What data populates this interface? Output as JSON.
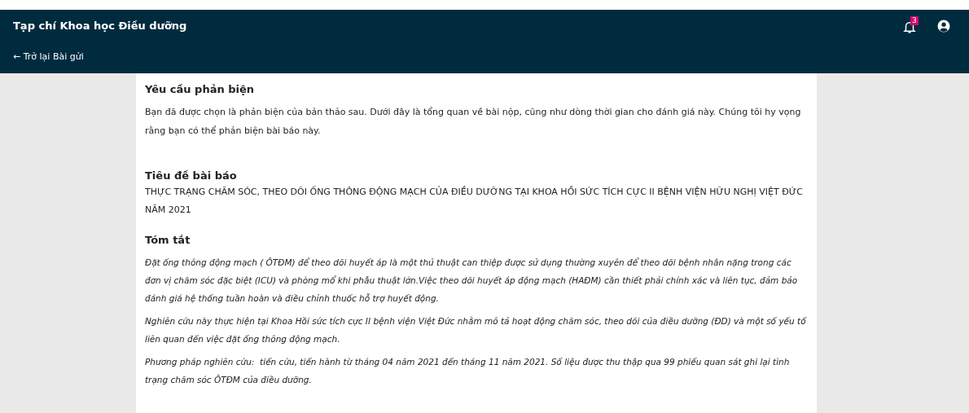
{
  "header": {
    "title": "Tạp chí Khoa học Điều dưỡng",
    "back_link": "← Trở lại Bài gửi",
    "notifications": {
      "count": "3"
    }
  },
  "content": {
    "request": {
      "heading": "Yêu cầu phản biện",
      "text": "Bạn đã được chọn là phản biện của bản thảo sau. Dưới đây là tổng quan về bài nộp, cũng như dòng thời gian cho đánh giá này. Chúng tôi hy vọng rằng bạn có thể phản biện bài báo này."
    },
    "title_section": {
      "heading": "Tiêu đề bài báo",
      "text": "THỰC TRẠNG CHĂM SÓC, THEO DÕI ỐNG THÔNG ĐỘNG MẠCH CỦA ĐIỀU DƯỠNG TẠI KHOA HỒI SỨC TÍCH CỰC II BỆNH VIỆN HỮU NGHỊ VIỆT ĐỨC NĂM 2021"
    },
    "abstract": {
      "heading": "Tóm tắt",
      "paragraphs": [
        "Đặt ống thông động mạch ( ÔTĐM) để theo dõi huyết áp là một thủ thuật can thiệp được sử dụng thường xuyên để theo dõi bệnh nhân nặng trong các đơn vị chăm sóc đặc biệt (ICU) và phòng mổ khi phẫu thuật lớn.Việc theo dõi huyết áp động mạch (HAĐM) cần thiết phải chính xác và liên tục, đảm bảo đánh giá hệ thống tuần hoàn và điều chỉnh thuốc hỗ trợ huyết động.",
        "Nghiên cứu này thực hiện tại Khoa Hồi sức tích cực II bệnh viện Việt Đức nhằm mô tả hoạt động chăm sóc, theo dõi của điều dưỡng (ĐD) và một số yếu tố liên quan đến việc đặt ống thông động mạch.",
        "Phương pháp nghiên cứu:  tiến cứu, tiến hành từ tháng 04 năm 2021 đến tháng 11 năm 2021. Số liệu được thu thập qua 99 phiếu quan sát ghi lại tình trạng chăm sóc ÔTĐM của điều dưỡng."
      ]
    }
  }
}
